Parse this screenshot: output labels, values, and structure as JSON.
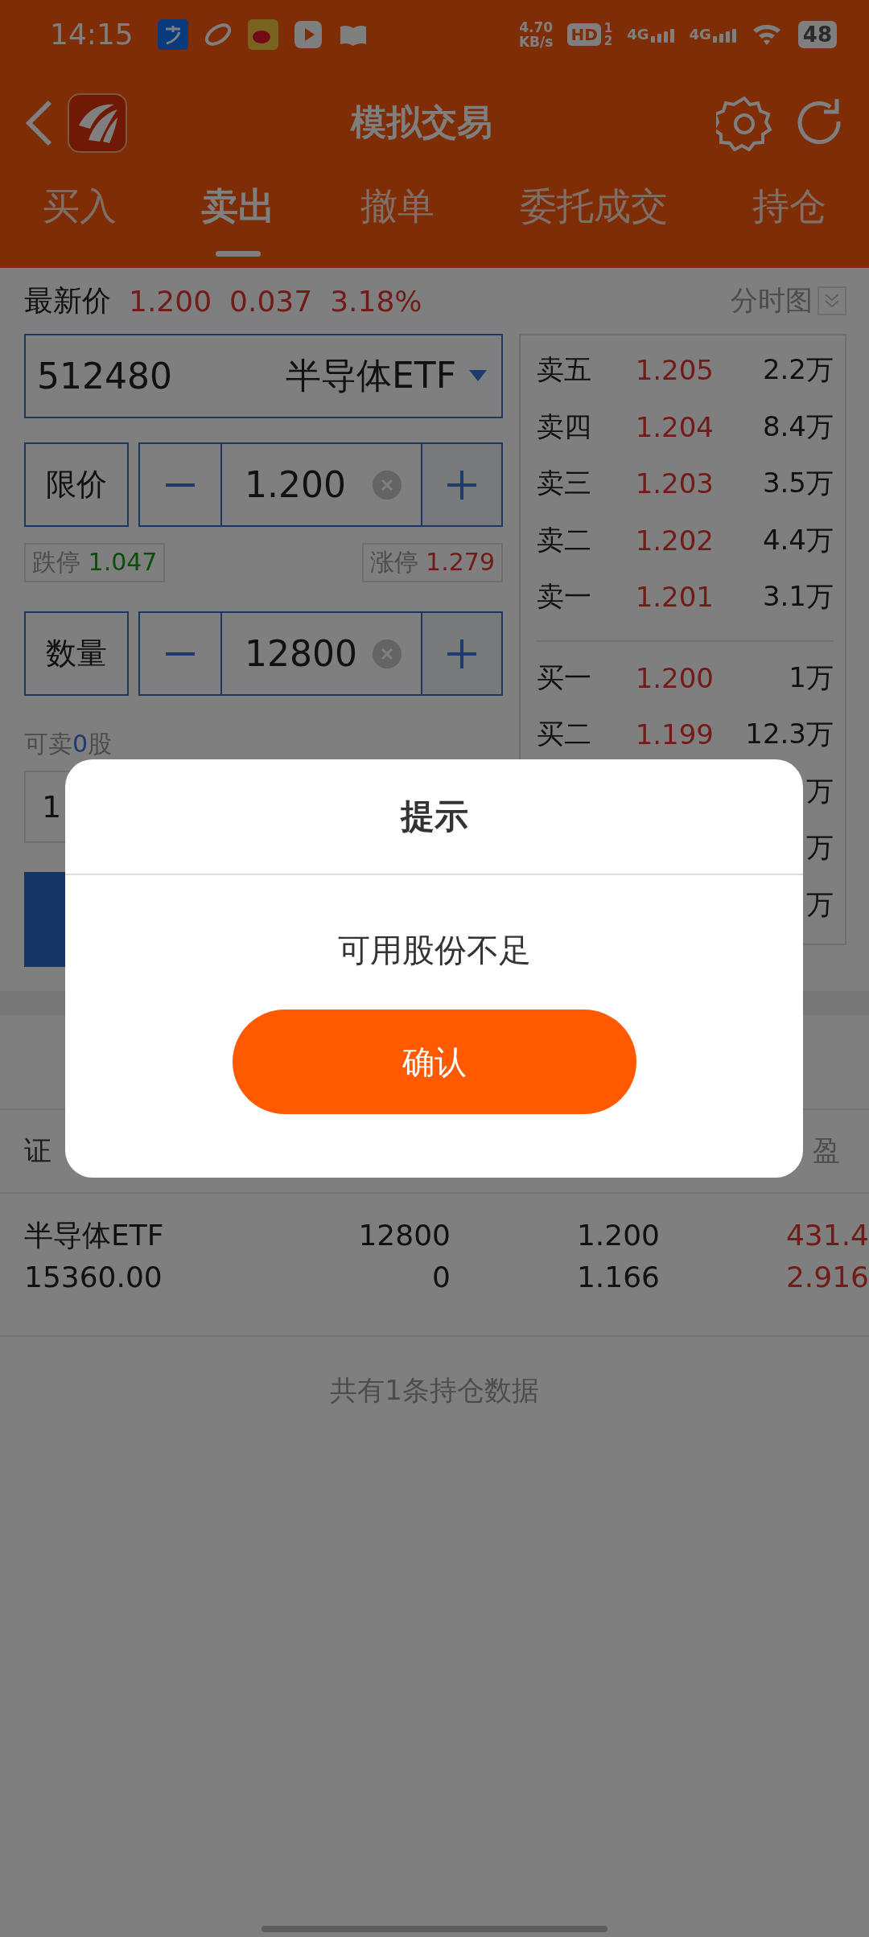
{
  "status_bar": {
    "time": "14:15",
    "net_speed": "4.70",
    "net_unit": "KB/s",
    "hd": "HD",
    "sim_1": "1",
    "sim_2": "2",
    "signal_1": "4G",
    "signal_2": "4G",
    "battery": "48"
  },
  "header": {
    "title": "模拟交易"
  },
  "tabs": [
    {
      "label": "买入",
      "selected": false
    },
    {
      "label": "卖出",
      "selected": true
    },
    {
      "label": "撤单",
      "selected": false
    },
    {
      "label": "委托成交",
      "selected": false
    },
    {
      "label": "持仓",
      "selected": false
    }
  ],
  "quote": {
    "label": "最新价",
    "price": "1.200",
    "change": "0.037",
    "change_pct": "3.18%",
    "chart_link": "分时图"
  },
  "stock": {
    "code": "512480",
    "name": "半导体ETF"
  },
  "price_field": {
    "label": "限价",
    "value": "1.200"
  },
  "limits": {
    "down_label": "跌停",
    "down_value": "1.047",
    "up_label": "涨停",
    "up_value": "1.279"
  },
  "qty_field": {
    "label": "数量",
    "value": "12800"
  },
  "sellable": {
    "prefix": "可卖",
    "count": "0",
    "suffix": "股"
  },
  "quick_qty": {
    "first": "1"
  },
  "order_book": {
    "asks": [
      {
        "label": "卖五",
        "price": "1.205",
        "volume": "2.2万"
      },
      {
        "label": "卖四",
        "price": "1.204",
        "volume": "8.4万"
      },
      {
        "label": "卖三",
        "price": "1.203",
        "volume": "3.5万"
      },
      {
        "label": "卖二",
        "price": "1.202",
        "volume": "4.4万"
      },
      {
        "label": "卖一",
        "price": "1.201",
        "volume": "3.1万"
      }
    ],
    "bids": [
      {
        "label": "买一",
        "price": "1.200",
        "volume": "1万"
      },
      {
        "label": "买二",
        "price": "1.199",
        "volume": "12.3万"
      },
      {
        "volume": "万"
      },
      {
        "volume": "万"
      },
      {
        "volume": "万"
      }
    ]
  },
  "positions": {
    "columns": [
      "证",
      "盈"
    ],
    "rows": [
      {
        "name": "半导体ETF",
        "value": "15360.00",
        "qty": "12800",
        "available": "0",
        "price": "1.200",
        "cost": "1.166",
        "pnl": "431.4",
        "pnl_pct": "2.916"
      }
    ],
    "footer": "共有1条持仓数据"
  },
  "dialog": {
    "title": "提示",
    "message": "可用股份不足",
    "button": "确认"
  }
}
